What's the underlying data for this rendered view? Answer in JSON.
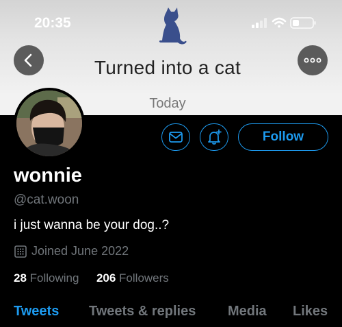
{
  "status_bar": {
    "time": "20:35"
  },
  "header": {
    "banner_title": "Turned into a cat",
    "banner_subtitle": "Today"
  },
  "profile": {
    "name": "wonnie",
    "handle": "@cat.woon",
    "bio": "i just wanna be your dog..?",
    "joined": "Joined June 2022",
    "following_count": "28",
    "following_label": "Following",
    "followers_count": "206",
    "followers_label": "Followers"
  },
  "actions": {
    "follow_label": "Follow"
  },
  "tabs": [
    {
      "label": "Tweets",
      "active": true
    },
    {
      "label": "Tweets & replies",
      "active": false
    },
    {
      "label": "Media",
      "active": false
    },
    {
      "label": "Likes",
      "active": false
    }
  ],
  "colors": {
    "accent": "#1d9bf0",
    "secondary_text": "#71767b",
    "background": "#000000"
  },
  "icons": [
    "back-arrow-icon",
    "more-icon",
    "mail-icon",
    "bell-plus-icon",
    "calendar-icon",
    "cat-logo-icon",
    "signal-icon",
    "wifi-icon",
    "battery-icon"
  ]
}
